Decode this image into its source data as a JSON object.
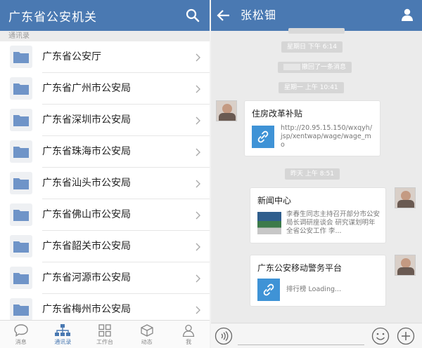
{
  "left_panel": {
    "title": "广东省公安机关",
    "section_label": "通讯录",
    "items": [
      {
        "label": "广东省公安厅"
      },
      {
        "label": "广东省广州市公安局"
      },
      {
        "label": "广东省深圳市公安局"
      },
      {
        "label": "广东省珠海市公安局"
      },
      {
        "label": "广东省汕头市公安局"
      },
      {
        "label": "广东省佛山市公安局"
      },
      {
        "label": "广东省韶关市公安局"
      },
      {
        "label": "广东省河源市公安局"
      },
      {
        "label": "广东省梅州市公安局"
      }
    ],
    "tabs": [
      {
        "label": "消息",
        "icon": "chat-icon"
      },
      {
        "label": "通讯录",
        "icon": "org-chart-icon",
        "active": true
      },
      {
        "label": "工作台",
        "icon": "grid-icon"
      },
      {
        "label": "动态",
        "icon": "cube-icon"
      },
      {
        "label": "我",
        "icon": "person-icon"
      }
    ]
  },
  "chat": {
    "contact_name": "张松钿",
    "timestamps": {
      "t1": "星期日  下午 6:14",
      "recall": "撤回了一条消息",
      "t2": "星期一  上午 10:41",
      "t3": "昨天  上午 8:51"
    },
    "msg1": {
      "title": "住房改革补贴",
      "link_text": "http://20.95.15.150/wxqyh/jsp/xentwap/wage/wage_mo"
    },
    "msg2": {
      "title": "新闻中心",
      "text": "李春生同志主持召开部分市公安局长调研座谈会 研究谋划明年全省公安工作 李..."
    },
    "msg3": {
      "title": "广东公安移动警务平台",
      "text": "排行榜 Loading..."
    }
  },
  "colors": {
    "header": "#4a79b2",
    "link_icon": "#3f93d6"
  }
}
